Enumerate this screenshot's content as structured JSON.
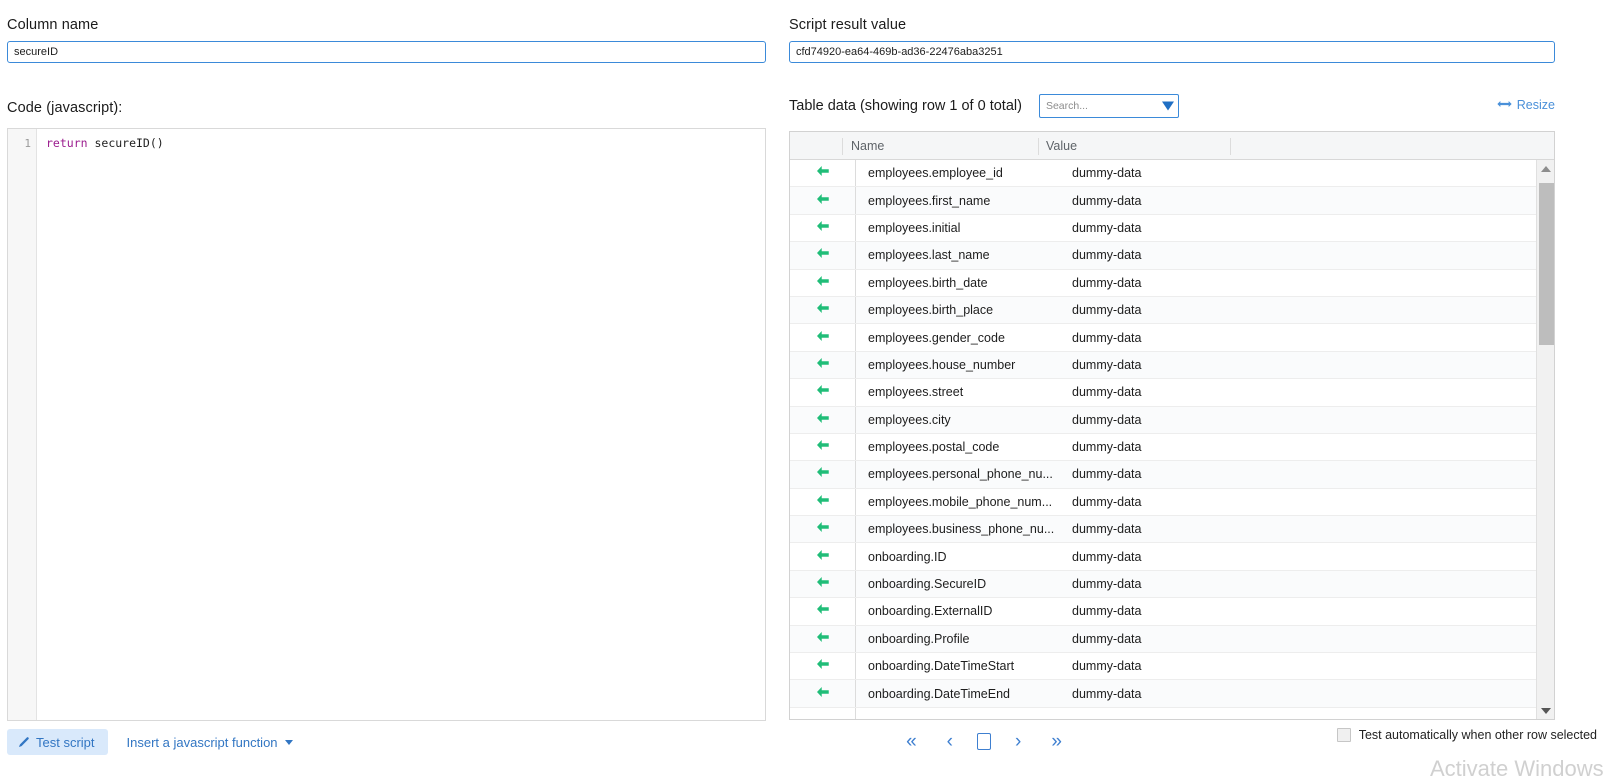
{
  "left_panel": {
    "column_name_label": "Column name",
    "column_name_value": "secureID",
    "code_label": "Code (javascript):",
    "code_line_number": "1",
    "code_keyword": "return",
    "code_expression": " secureID()",
    "test_script_label": "Test script",
    "insert_function_label": "Insert a javascript function",
    "test_script_icon": "pencil-icon",
    "insert_caret_icon": "caret-down-icon"
  },
  "right_panel": {
    "script_result_label": "Script result value",
    "script_result_value": "cfd74920-ea64-469b-ad36-22476aba3251",
    "table_data_label": "Table data (showing row 1 of 0 total)",
    "search_placeholder": "Search...",
    "search_value": "",
    "search_dropdown_icon": "filter-dropdown-icon",
    "resize_label": "Resize",
    "resize_icon": "resize-horizontal-icon",
    "columns": [
      "",
      "Name",
      "Value",
      ""
    ],
    "row_arrow_icon": "arrow-left-icon",
    "rows": [
      {
        "name": "employees.employee_id",
        "value": "dummy-data"
      },
      {
        "name": "employees.first_name",
        "value": "dummy-data"
      },
      {
        "name": "employees.initial",
        "value": "dummy-data"
      },
      {
        "name": "employees.last_name",
        "value": "dummy-data"
      },
      {
        "name": "employees.birth_date",
        "value": "dummy-data"
      },
      {
        "name": "employees.birth_place",
        "value": "dummy-data"
      },
      {
        "name": "employees.gender_code",
        "value": "dummy-data"
      },
      {
        "name": "employees.house_number",
        "value": "dummy-data"
      },
      {
        "name": "employees.street",
        "value": "dummy-data"
      },
      {
        "name": "employees.city",
        "value": "dummy-data"
      },
      {
        "name": "employees.postal_code",
        "value": "dummy-data"
      },
      {
        "name": "employees.personal_phone_nu...",
        "value": "dummy-data"
      },
      {
        "name": "employees.mobile_phone_num...",
        "value": "dummy-data"
      },
      {
        "name": "employees.business_phone_nu...",
        "value": "dummy-data"
      },
      {
        "name": "onboarding.ID",
        "value": "dummy-data"
      },
      {
        "name": "onboarding.SecureID",
        "value": "dummy-data"
      },
      {
        "name": "onboarding.ExternalID",
        "value": "dummy-data"
      },
      {
        "name": "onboarding.Profile",
        "value": "dummy-data"
      },
      {
        "name": "onboarding.DateTimeStart",
        "value": "dummy-data"
      },
      {
        "name": "onboarding.DateTimeEnd",
        "value": "dummy-data"
      },
      {
        "name": "",
        "value": ""
      }
    ],
    "pagination": {
      "first_label": "«",
      "prev_label": "‹",
      "current_label": "",
      "next_label": "›",
      "last_label": "»"
    },
    "auto_test_label": "Test automatically when other row selected",
    "auto_test_checked": false
  },
  "watermark": "Activate Windows",
  "colors": {
    "accent_blue": "#3276c3",
    "input_border_blue": "#3b8ad9",
    "arrow_green": "#20bd78",
    "keyword_purple": "#9b1c8e",
    "header_bg": "#f5f6f7"
  }
}
